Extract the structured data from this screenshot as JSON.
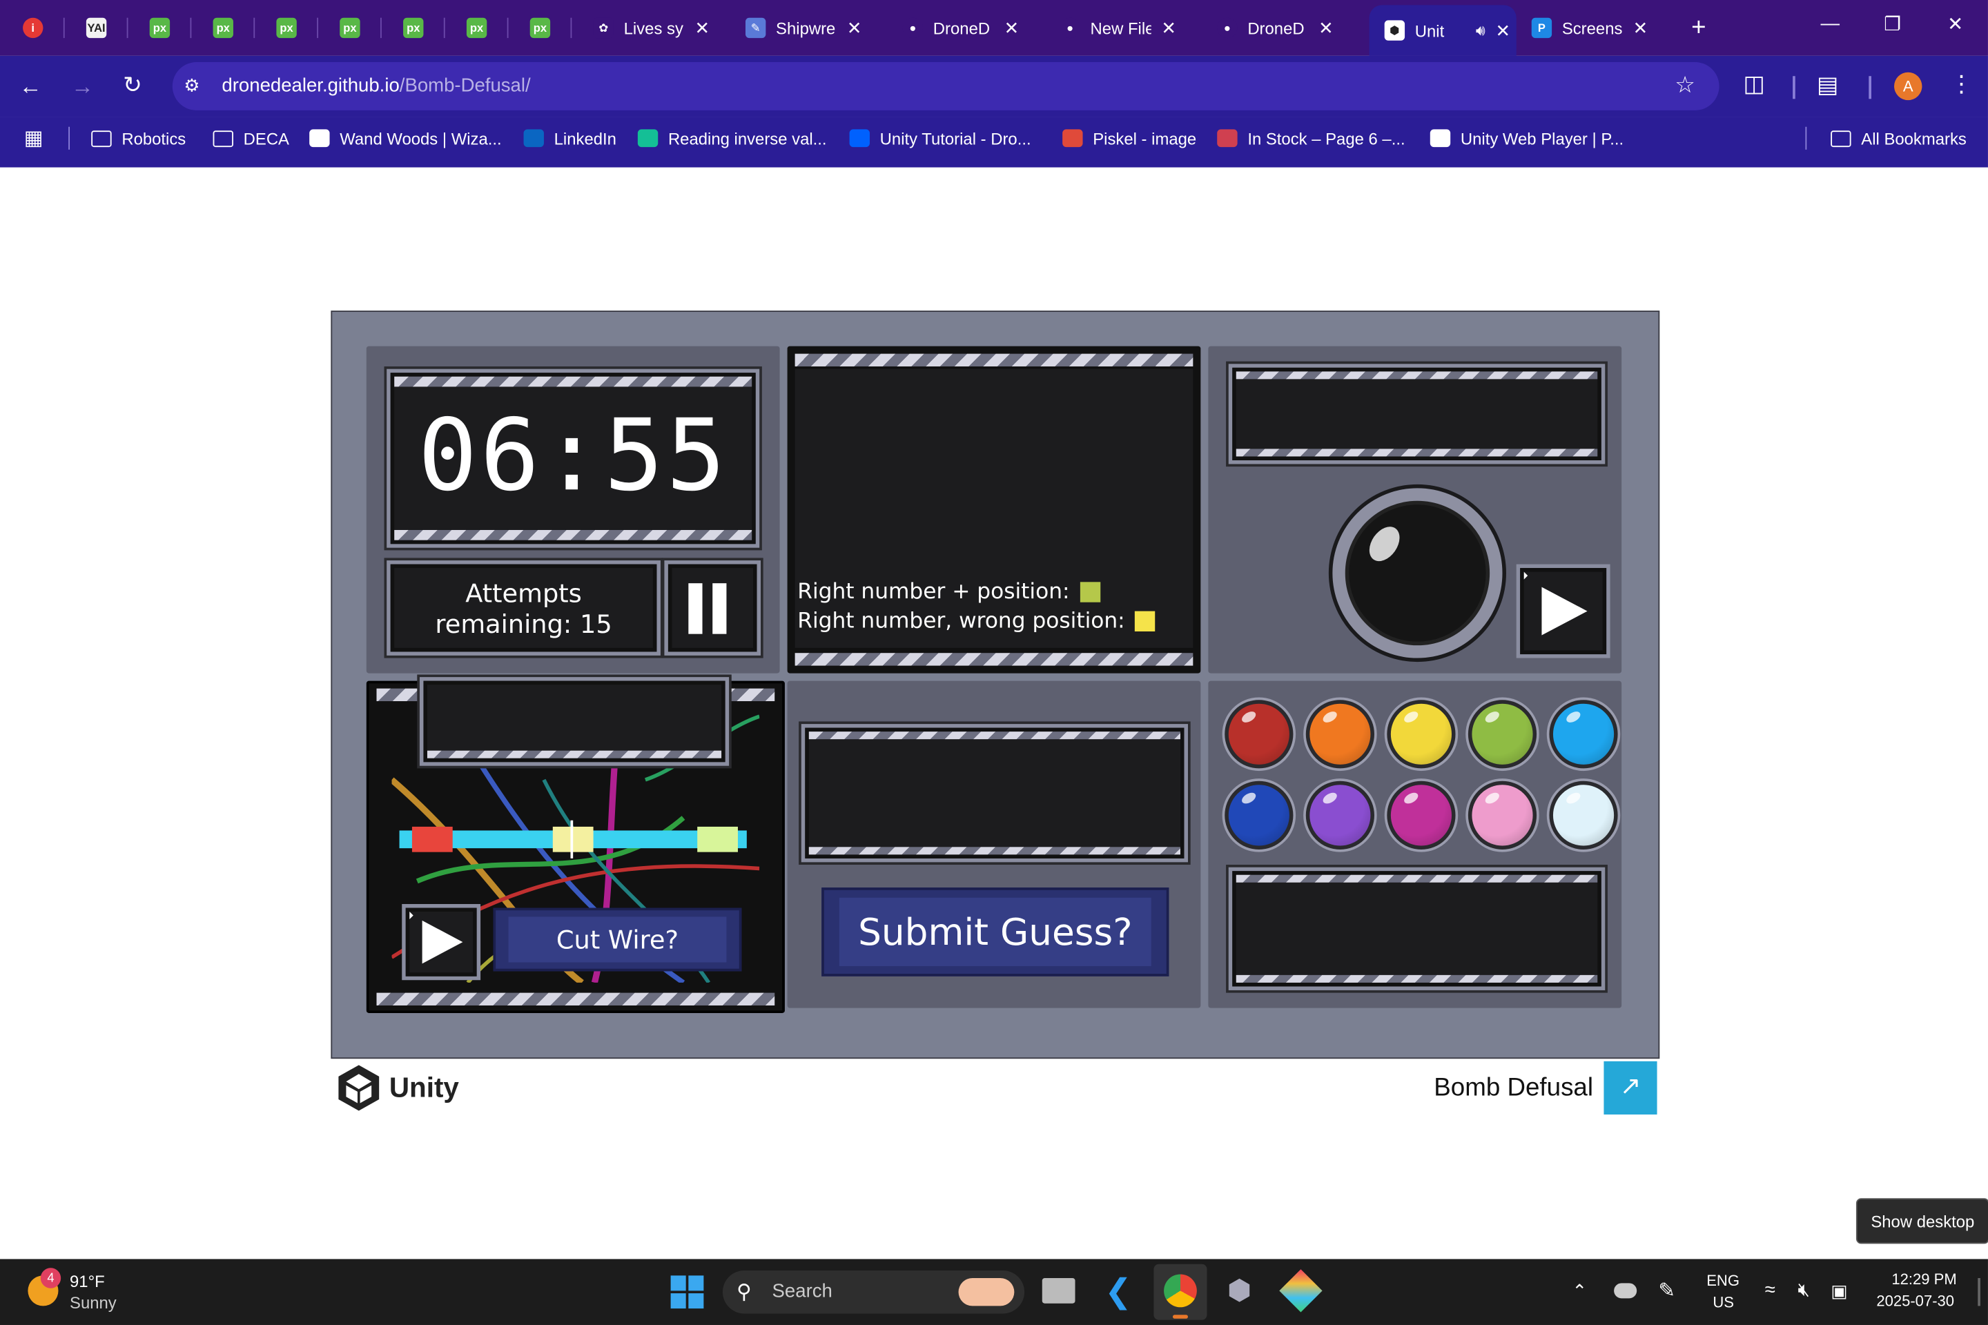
{
  "browser": {
    "tabs": [
      {
        "icon": "info-icon",
        "title": ""
      },
      {
        "icon": "yai-icon",
        "title": "YAI"
      },
      {
        "icon": "pixilart-icon",
        "title": "px"
      },
      {
        "icon": "pixilart-icon",
        "title": "px"
      },
      {
        "icon": "pixilart-icon",
        "title": "px"
      },
      {
        "icon": "pixilart-icon",
        "title": "px"
      },
      {
        "icon": "pixilart-icon",
        "title": "px"
      },
      {
        "icon": "pixilart-icon",
        "title": "px"
      },
      {
        "icon": "pixilart-icon",
        "title": "px"
      },
      {
        "icon": "openai-icon",
        "title": "Lives sy"
      },
      {
        "icon": "shipwreck-icon",
        "title": "Shipwre"
      },
      {
        "icon": "github-icon",
        "title": "DroneD"
      },
      {
        "icon": "github-icon",
        "title": "New File"
      },
      {
        "icon": "github-icon",
        "title": "DroneD"
      },
      {
        "icon": "unity-icon",
        "title": "Unit"
      },
      {
        "icon": "screenshot-icon",
        "title": "Screens"
      }
    ],
    "new_tab_glyph": "+",
    "url_domain": "dronedealer.github.io",
    "url_path": "/Bomb-Defusal/",
    "profile_initial": "A",
    "bookmarks": [
      {
        "icon": "folder-icon",
        "label": "Robotics"
      },
      {
        "icon": "folder-icon",
        "label": "DECA"
      },
      {
        "icon": "wandwoods-icon",
        "label": "Wand Woods | Wiza..."
      },
      {
        "icon": "linkedin-icon",
        "label": "LinkedIn"
      },
      {
        "icon": "khan-icon",
        "label": "Reading inverse val..."
      },
      {
        "icon": "dropbox-icon",
        "label": "Unity Tutorial - Dro..."
      },
      {
        "icon": "piskel-icon",
        "label": "Piskel - image"
      },
      {
        "icon": "shop-icon",
        "label": "In Stock – Page 6 –..."
      },
      {
        "icon": "unity-icon",
        "label": "Unity Web Player | P..."
      }
    ],
    "all_bookmarks": "All Bookmarks"
  },
  "game": {
    "timer": "06:55",
    "attempts_line1": "Attempts",
    "attempts_line2": "remaining: 15",
    "hint_right_position": "Right number + position:",
    "hint_wrong_position": "Right number, wrong position:",
    "cut_wire_label": "Cut Wire?",
    "submit_label": "Submit Guess?",
    "colors": {
      "right_position": "#b5c84a",
      "wrong_position": "#f5e34a",
      "wire_bar": "#3ad2f0",
      "wire_red": "#e8453c",
      "wire_yellow": "#f4f0a0",
      "wire_green": "#d8f59a"
    },
    "buttons": [
      {
        "name": "red",
        "color": "#b8302a"
      },
      {
        "name": "orange",
        "color": "#f07820"
      },
      {
        "name": "yellow",
        "color": "#f2d83a"
      },
      {
        "name": "green",
        "color": "#8fbc44"
      },
      {
        "name": "blue",
        "color": "#1ea6ee"
      },
      {
        "name": "navy",
        "color": "#2048b8"
      },
      {
        "name": "purple",
        "color": "#8a4ed0"
      },
      {
        "name": "magenta",
        "color": "#c0309a"
      },
      {
        "name": "pink",
        "color": "#ee9ccc"
      },
      {
        "name": "white",
        "color": "#dff2fa"
      }
    ]
  },
  "footer": {
    "unity_logo_text": "Unity",
    "game_title": "Bomb Defusal"
  },
  "tooltip": "Show desktop",
  "taskbar": {
    "weather_badge": "4",
    "temperature": "91°F",
    "condition": "Sunny",
    "search_label": "Search",
    "lang_line1": "ENG",
    "lang_line2": "US",
    "time": "12:29 PM",
    "date": "2025-07-30"
  }
}
